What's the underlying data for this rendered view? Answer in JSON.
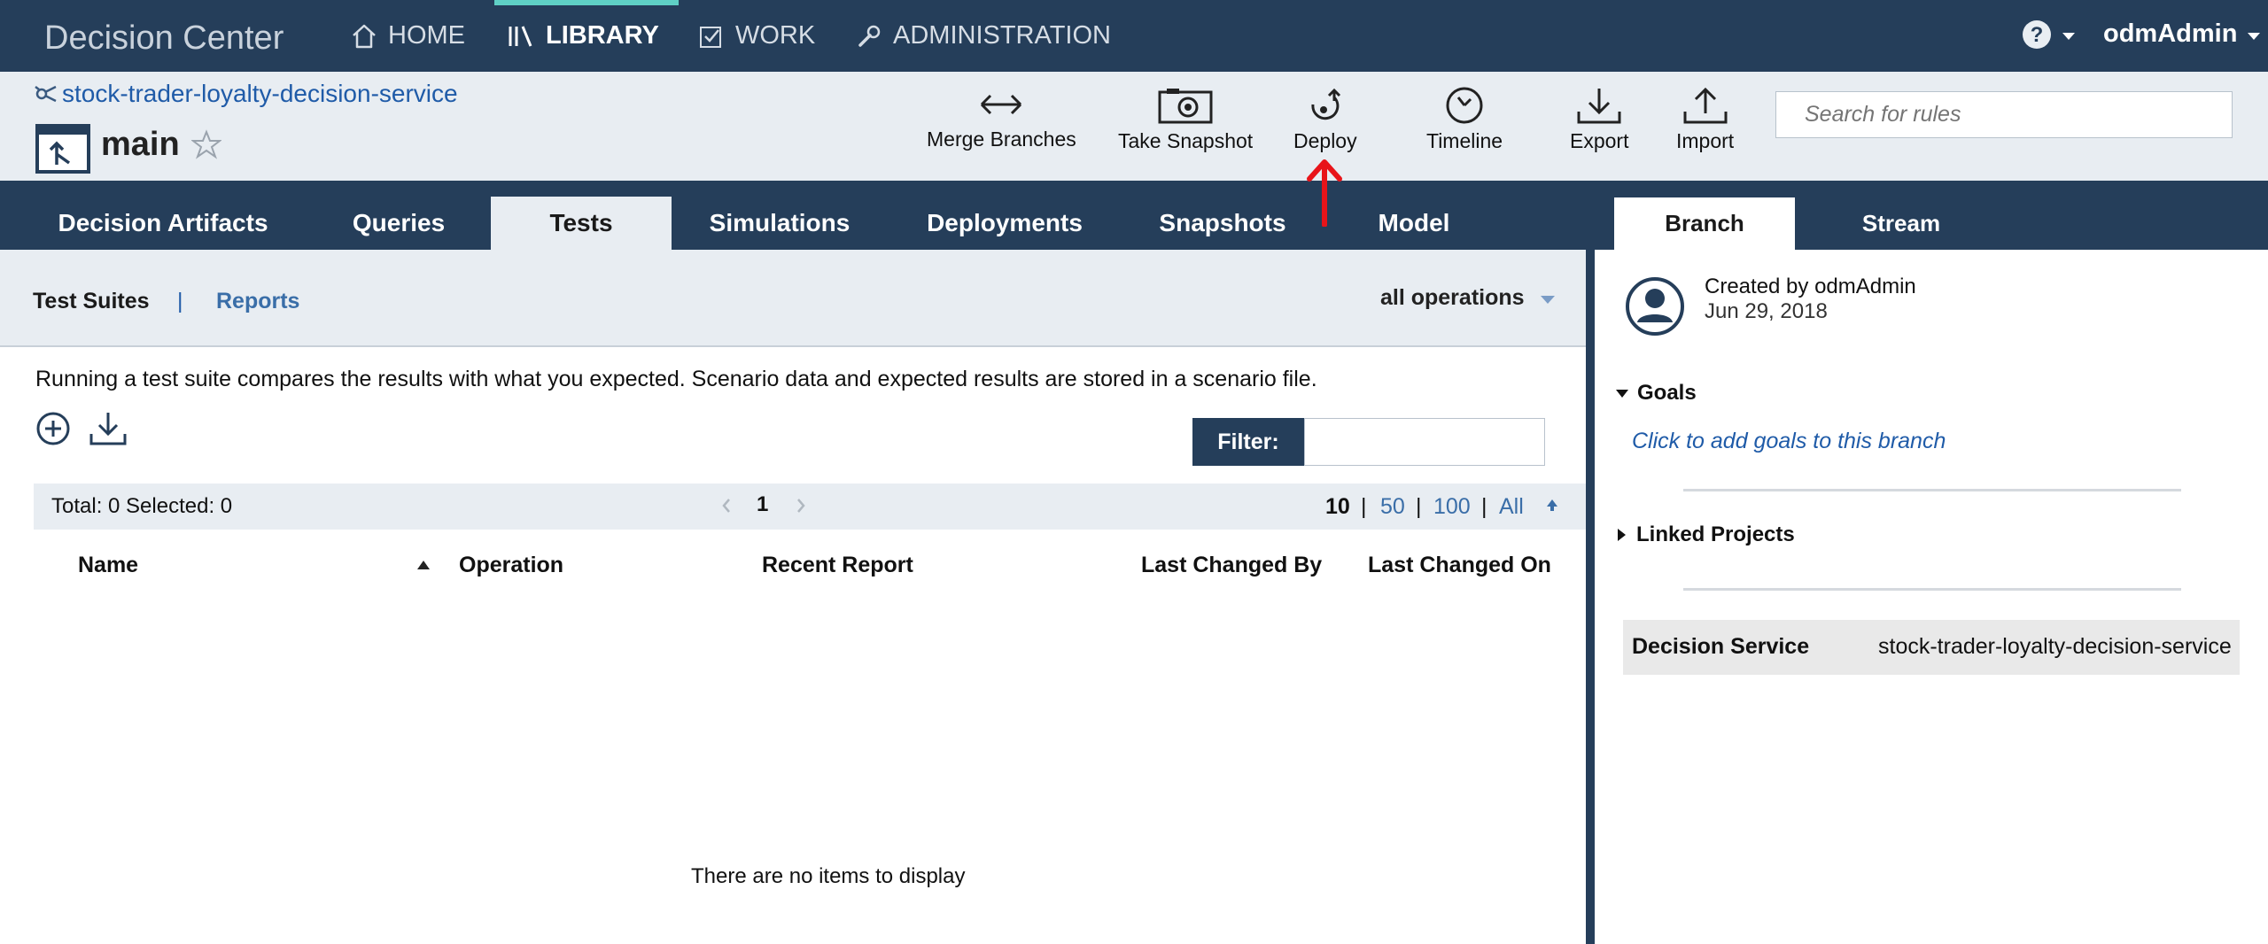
{
  "app": {
    "title": "Decision Center"
  },
  "nav": {
    "home": "HOME",
    "library": "LIBRARY",
    "work": "WORK",
    "administration": "ADMINISTRATION",
    "user": "odmAdmin"
  },
  "header": {
    "project": "stock-trader-loyalty-decision-service",
    "branch": "main",
    "tools": {
      "merge": "Merge Branches",
      "snapshot": "Take Snapshot",
      "deploy": "Deploy",
      "timeline": "Timeline",
      "export": "Export",
      "import": "Import"
    },
    "search_placeholder": "Search for rules"
  },
  "tabs": {
    "artifacts": "Decision Artifacts",
    "queries": "Queries",
    "tests": "Tests",
    "simulations": "Simulations",
    "deployments": "Deployments",
    "snapshots": "Snapshots",
    "model": "Model",
    "active": "Tests"
  },
  "right_tabs": {
    "branch": "Branch",
    "stream": "Stream",
    "active": "Branch"
  },
  "subnav": {
    "test_suites": "Test Suites",
    "separator": "|",
    "reports": "Reports",
    "operations": "all operations"
  },
  "content": {
    "description": "Running a test suite compares the results with what you expected. Scenario data and expected results are stored in a scenario file.",
    "filter_label": "Filter:",
    "filter_value": "",
    "totals": "Total: 0 Selected: 0",
    "page": "1",
    "page_sizes": [
      "10",
      "50",
      "100",
      "All"
    ],
    "page_size_selected": "10",
    "columns": {
      "name": "Name",
      "operation": "Operation",
      "recent_report": "Recent Report",
      "last_changed_by": "Last Changed By",
      "last_changed_on": "Last Changed On"
    },
    "sort_column": "Name",
    "sort_direction": "ascending",
    "empty": "There are no items to display"
  },
  "side": {
    "created_by": "Created by odmAdmin",
    "created_date": "Jun 29, 2018",
    "goals": "Goals",
    "goals_link": "Click to add goals to this branch",
    "linked_projects": "Linked Projects",
    "decision_service_label": "Decision Service",
    "decision_service_value": "stock-trader-loyalty-decision-service"
  },
  "colors": {
    "navy": "#253e5a",
    "header_bg": "#e8edf2",
    "link_blue": "#1f5ba8",
    "accent_teal": "#5fd0c5",
    "annotation_red": "#e8141a"
  },
  "icons": {
    "home": "home-icon",
    "library": "library-icon",
    "work": "checkbox-icon",
    "administration": "wrench-icon",
    "help": "help-icon",
    "project": "project-icon",
    "branch": "branch-icon",
    "star": "star-icon",
    "merge": "double-arrow-icon",
    "snapshot": "camera-icon",
    "deploy": "deploy-icon",
    "timeline": "clock-icon",
    "export": "download-icon",
    "import": "upload-icon",
    "add": "add-circle-icon",
    "import_suite": "download-icon",
    "avatar": "user-avatar-icon"
  }
}
